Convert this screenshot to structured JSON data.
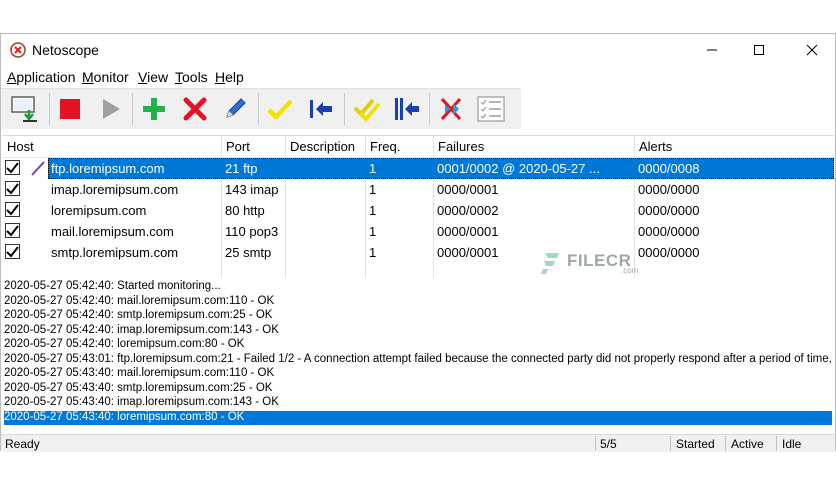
{
  "window": {
    "title": "Netoscope"
  },
  "menu": [
    "Application",
    "Monitor",
    "View",
    "Tools",
    "Help"
  ],
  "menu_underline": [
    "A",
    "M",
    "V",
    "T",
    "H"
  ],
  "toolbar": {
    "buttons": [
      "import-icon",
      "stop-icon",
      "play-icon",
      "add-icon",
      "delete-icon",
      "edit-icon",
      "check-icon",
      "move-left-icon",
      "check-all-icon",
      "move-left-all-icon",
      "clear-icon",
      "list-icon"
    ]
  },
  "grid": {
    "columns": [
      "Host",
      "Port",
      "Description",
      "Freq.",
      "Failures",
      "Alerts"
    ],
    "rows": [
      {
        "host": "ftp.loremipsum.com",
        "port": "21 ftp",
        "description": "",
        "freq": "1",
        "failures": "0001/0002 @ 2020-05-27 ...",
        "alerts": "0000/0008",
        "checked": true,
        "selected": true
      },
      {
        "host": "imap.loremipsum.com",
        "port": "143 imap",
        "description": "",
        "freq": "1",
        "failures": "0000/0001",
        "alerts": "0000/0000",
        "checked": true,
        "selected": false
      },
      {
        "host": "loremipsum.com",
        "port": "80 http",
        "description": "",
        "freq": "1",
        "failures": "0000/0002",
        "alerts": "0000/0000",
        "checked": true,
        "selected": false
      },
      {
        "host": "mail.loremipsum.com",
        "port": "110 pop3",
        "description": "",
        "freq": "1",
        "failures": "0000/0001",
        "alerts": "0000/0000",
        "checked": true,
        "selected": false
      },
      {
        "host": "smtp.loremipsum.com",
        "port": "25 smtp",
        "description": "",
        "freq": "1",
        "failures": "0000/0001",
        "alerts": "0000/0000",
        "checked": true,
        "selected": false
      }
    ]
  },
  "log": {
    "lines": [
      "2020-05-27 05:42:40: Started monitoring...",
      "2020-05-27 05:42:40: mail.loremipsum.com:110 - OK",
      "2020-05-27 05:42:40: smtp.loremipsum.com:25 - OK",
      "2020-05-27 05:42:40: imap.loremipsum.com:143 - OK",
      "2020-05-27 05:42:40: loremipsum.com:80 - OK",
      "2020-05-27 05:43:01: ftp.loremipsum.com:21 - Failed 1/2 - A connection attempt failed because the connected party did not properly respond after a period of time,",
      "2020-05-27 05:43:40: mail.loremipsum.com:110 - OK",
      "2020-05-27 05:43:40: smtp.loremipsum.com:25 - OK",
      "2020-05-27 05:43:40: imap.loremipsum.com:143 - OK",
      "2020-05-27 05:43:40: loremipsum.com:80 - OK"
    ],
    "selected_index": 9
  },
  "status": {
    "text": "Ready",
    "count": "5/5",
    "state1": "Started",
    "state2": "Active",
    "state3": "Idle"
  },
  "watermark": {
    "text": "FILECR",
    "sub": ".com"
  },
  "colors": {
    "selection": "#0078d7",
    "stop": "#e81123",
    "add": "#22b14c",
    "delete": "#e81123",
    "check": "#f2e200",
    "arrow": "#1a3fb0"
  }
}
